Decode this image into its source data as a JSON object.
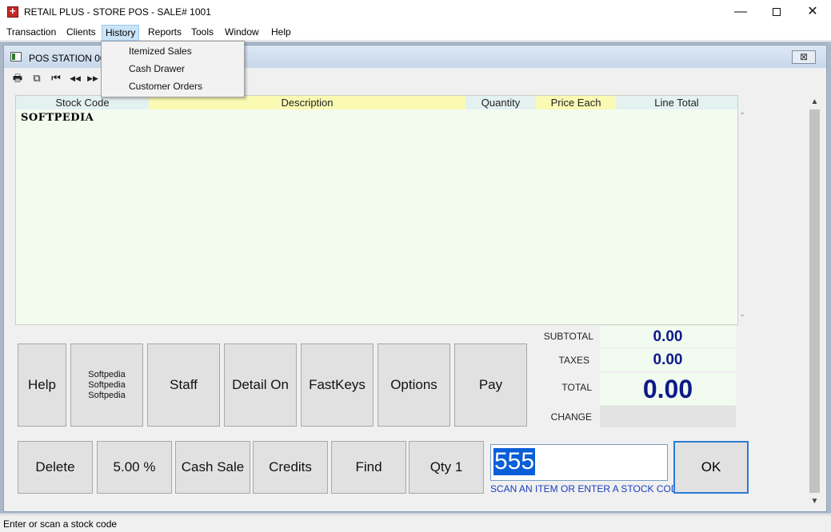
{
  "window": {
    "title": "RETAIL PLUS  -  STORE POS  -  SALE# 1001",
    "minimize": "—",
    "close": "✕"
  },
  "menu": {
    "items": [
      "Transaction",
      "Clients",
      "History",
      "Reports",
      "Tools",
      "Window",
      "Help"
    ],
    "active": "History"
  },
  "history_menu": {
    "items": [
      "Itemized Sales",
      "Cash Drawer",
      "Customer Orders"
    ]
  },
  "child_window": {
    "title": "POS STATION 001",
    "close_symbol": "⊠"
  },
  "toolbar": {
    "icons": [
      "printer-icon",
      "copy-icon",
      "first-icon",
      "prev-icon",
      "next-icon"
    ],
    "glyphs": [
      "🖶",
      "⧉",
      "⏮",
      "◀◀",
      "▶▶"
    ]
  },
  "grid": {
    "columns": [
      "Stock Code",
      "Description",
      "Quantity",
      "Price Each",
      "Line Total"
    ],
    "column_colors": [
      "#e3f1ef",
      "#fafab4",
      "#e3f1ef",
      "#fafab4",
      "#e3f1ef"
    ],
    "row_text": "SOFTPEDIA"
  },
  "buttons_row1": {
    "help": "Help",
    "softpedia_lines": [
      "Softpedia",
      "Softpedia",
      "Softpedia"
    ],
    "staff": "Staff",
    "detail": "Detail On",
    "fastkeys": "FastKeys",
    "options": "Options",
    "pay": "Pay"
  },
  "buttons_row2": {
    "delete": "Delete",
    "percent": "5.00 %",
    "cash_sale": "Cash Sale",
    "credits": "Credits",
    "find": "Find",
    "qty": "Qty 1"
  },
  "totals": {
    "subtotal_label": "SUBTOTAL",
    "subtotal": "0.00",
    "taxes_label": "TAXES",
    "taxes": "0.00",
    "total_label": "TOTAL",
    "total": "0.00",
    "change_label": "CHANGE",
    "change": ""
  },
  "scan": {
    "value": "555",
    "hint": "SCAN AN ITEM OR ENTER A STOCK CODE",
    "ok": "OK"
  },
  "status": {
    "text": "Enter or scan a stock code"
  },
  "colors": {
    "total_text": "#0c1a8a",
    "scan_highlight": "#0a5ed7",
    "grid_bg": "#f3fbef"
  }
}
